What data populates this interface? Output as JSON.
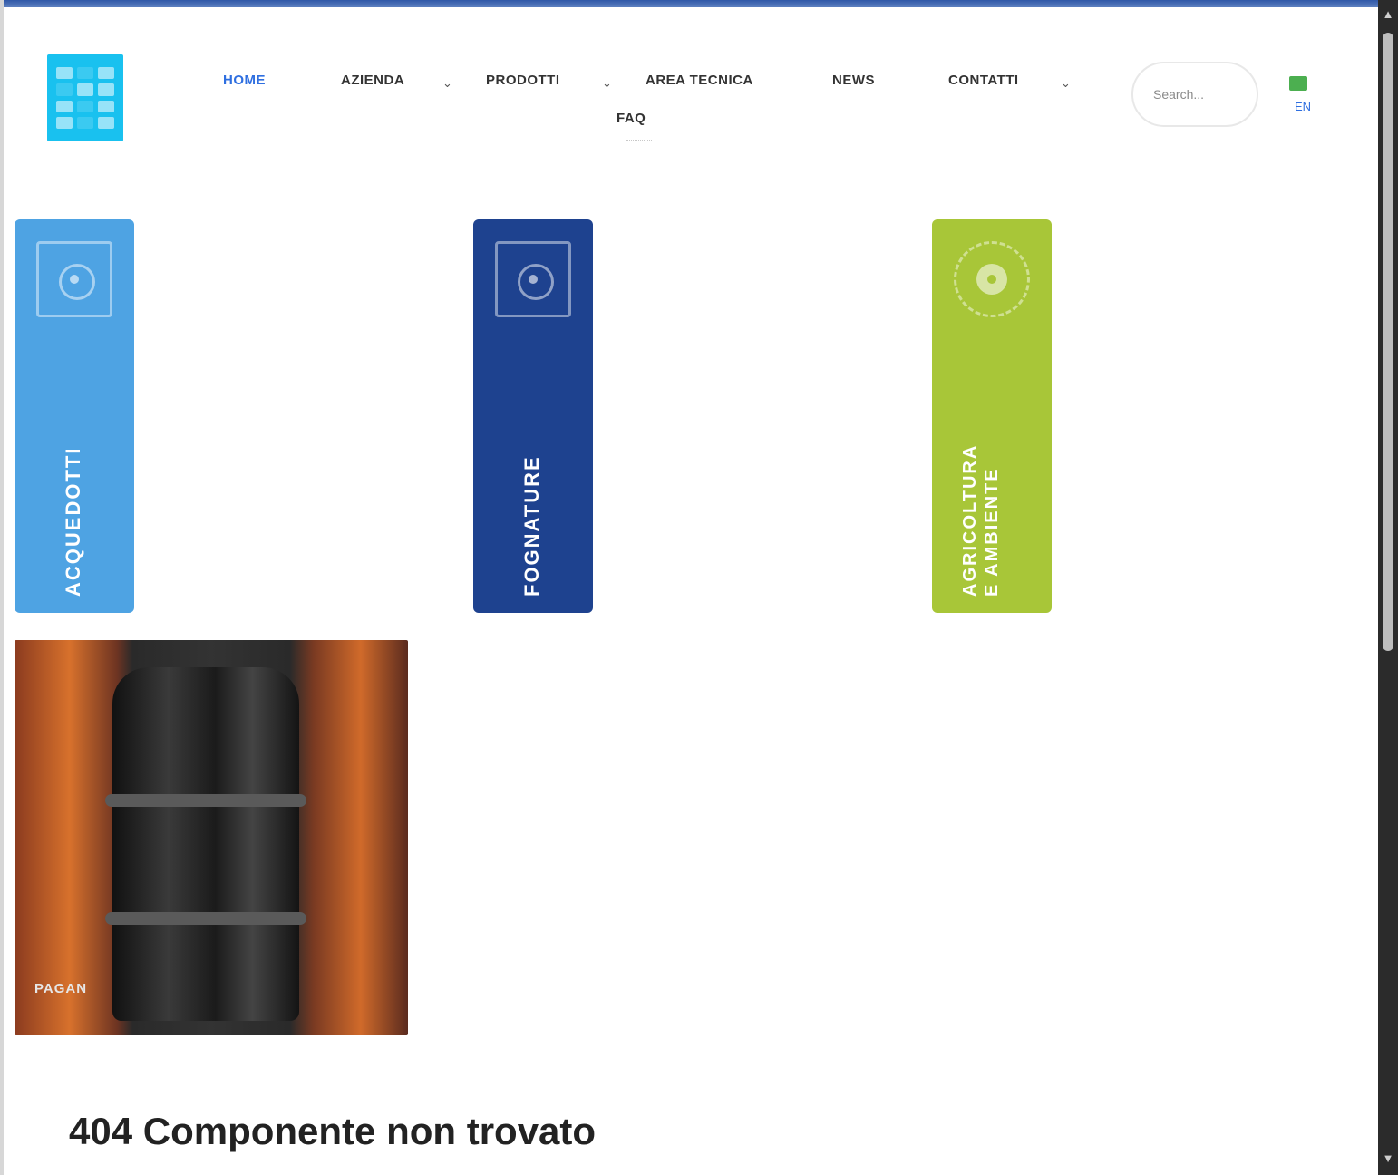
{
  "header": {
    "logo_icon": "grid-logo-icon",
    "nav": [
      {
        "label": "HOME",
        "active": true
      },
      {
        "label": "AZIENDA",
        "has_submenu": true
      },
      {
        "label": "PRODOTTI",
        "has_submenu": true
      },
      {
        "label": "AREA TECNICA"
      },
      {
        "label": "NEWS"
      },
      {
        "label": "CONTATTI",
        "has_submenu": true
      },
      {
        "label": "FAQ"
      }
    ],
    "caret_glyph": "⌄",
    "search": {
      "placeholder": "Search..."
    },
    "language": {
      "code": "EN",
      "flag_color": "#4caf50"
    }
  },
  "tabs": [
    {
      "label": "ACQUEDOTTI",
      "color": "#4ea3e3",
      "icon": "target-icon"
    },
    {
      "label": "FOGNATURE",
      "color": "#1e428f",
      "icon": "target-icon"
    },
    {
      "label": "AGRICOLTURA\nE AMBIENTE",
      "color": "#a8c638",
      "icon": "sun-icon"
    }
  ],
  "photo": {
    "caption": "PAGAN"
  },
  "main": {
    "heading": "404 Componente non trovato"
  },
  "colors": {
    "accent": "#2f6fe0",
    "logo": "#19c1ef"
  }
}
